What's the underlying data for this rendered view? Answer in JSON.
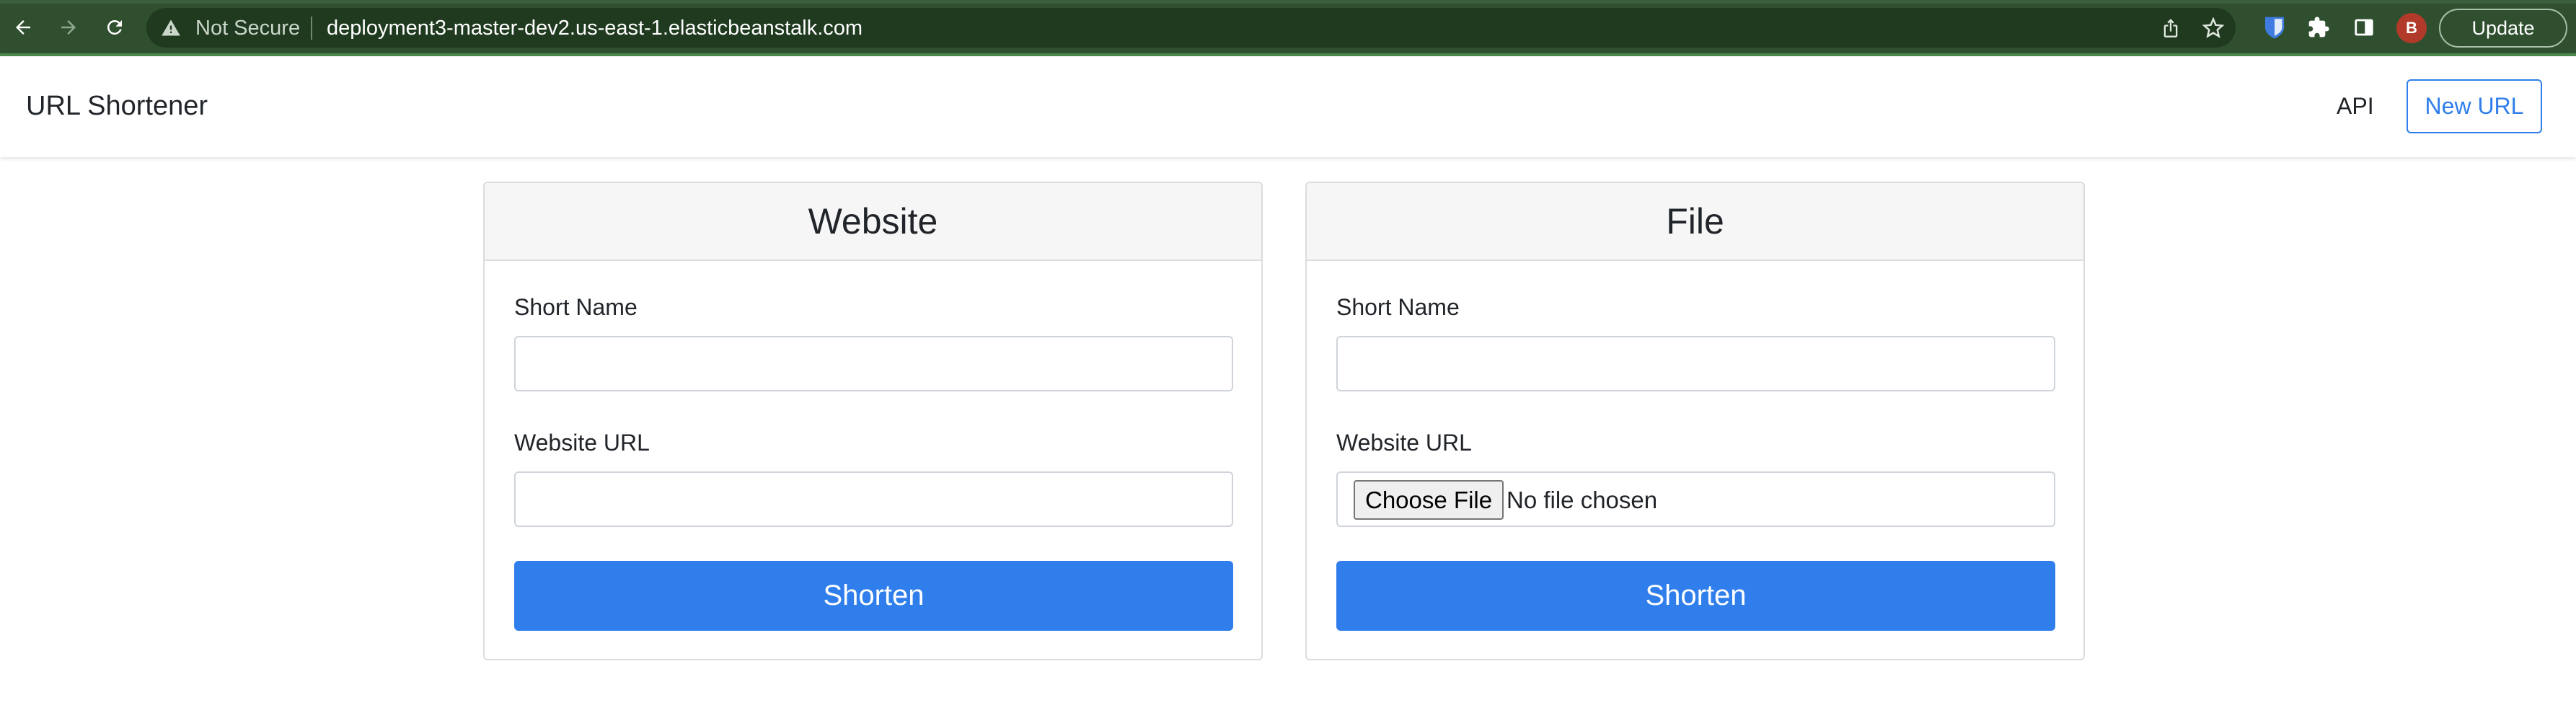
{
  "browser": {
    "security_label": "Not Secure",
    "url": "deployment3-master-dev2.us-east-1.elasticbeanstalk.com",
    "profile_initial": "B",
    "update_label": "Update",
    "icons": [
      "back-icon",
      "forward-icon",
      "reload-icon",
      "warning-icon",
      "share-icon",
      "bookmark-star-icon",
      "bitwarden-icon",
      "extensions-icon",
      "side-panel-icon"
    ]
  },
  "navbar": {
    "brand": "URL Shortener",
    "api_link": "API",
    "new_url_button": "New URL"
  },
  "website_card": {
    "title": "Website",
    "short_name_label": "Short Name",
    "short_name_value": "",
    "url_label": "Website URL",
    "url_value": "",
    "submit_label": "Shorten"
  },
  "file_card": {
    "title": "File",
    "short_name_label": "Short Name",
    "short_name_value": "",
    "url_label": "Website URL",
    "choose_file_label": "Choose File",
    "no_file_text": "No file chosen",
    "submit_label": "Shorten"
  },
  "colors": {
    "chrome_bg": "#2f4f2f",
    "omnibox_bg": "#203a20",
    "primary": "#2f7eeb",
    "card_header_bg": "#f6f6f6",
    "avatar_bg": "#b23a2a"
  }
}
